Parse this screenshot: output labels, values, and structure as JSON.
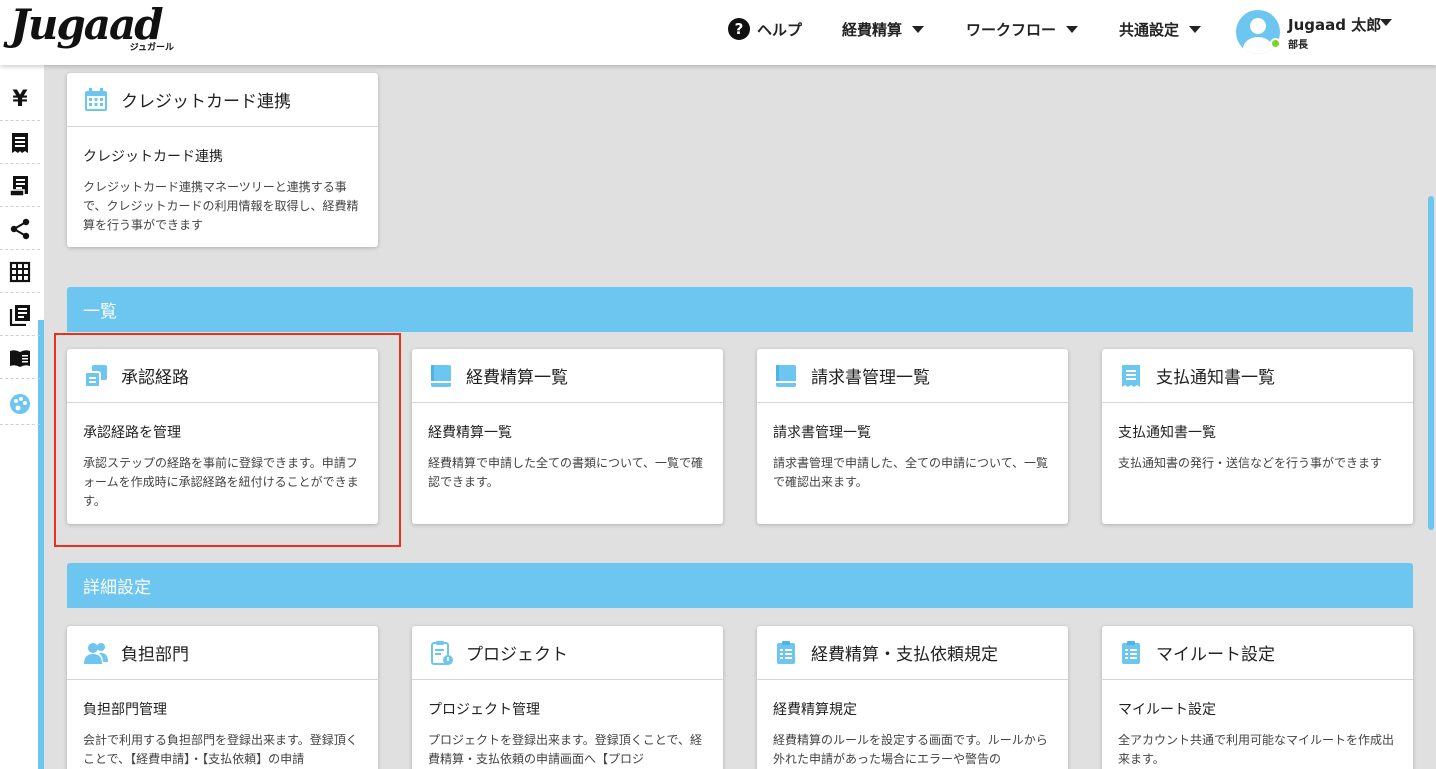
{
  "colors": {
    "accent": "#6cc6ef",
    "highlight": "#e8321c",
    "status_online": "#7ed321"
  },
  "header": {
    "logo_text": "Jugaad",
    "logo_sub": "ジュガール",
    "nav": {
      "help": "ヘルプ",
      "expense": "経費精算",
      "workflow": "ワークフロー",
      "common": "共通設定"
    },
    "user": {
      "name": "Jugaad 太郎",
      "role": "部長"
    }
  },
  "sidebar": {
    "icons": [
      "yen-icon",
      "receipt-icon",
      "invoice-icon",
      "share-icon",
      "grid-icon",
      "library-icon",
      "book-icon",
      "palette-icon"
    ]
  },
  "top_card": {
    "title": "クレジットカード連携",
    "subtitle": "クレジットカード連携",
    "desc": "クレジットカード連携マネーツリーと連携する事で、クレジットカードの利用情報を取得し、経費精算を行う事ができます"
  },
  "sections": {
    "list": "一覧",
    "detail": "詳細設定"
  },
  "list_cards": [
    {
      "title": "承認経路",
      "subtitle": "承認経路を管理",
      "desc": "承認ステップの経路を事前に登録できます。申請フォームを作成時に承認経路を紐付けることができます。"
    },
    {
      "title": "経費精算一覧",
      "subtitle": "経費精算一覧",
      "desc": "経費精算で申請した全ての書類について、一覧で確認できます。"
    },
    {
      "title": "請求書管理一覧",
      "subtitle": "請求書管理一覧",
      "desc": "請求書管理で申請した、全ての申請について、一覧で確認出来ます。"
    },
    {
      "title": "支払通知書一覧",
      "subtitle": "支払通知書一覧",
      "desc": "支払通知書の発行・送信などを行う事ができます"
    }
  ],
  "detail_cards": [
    {
      "title": "負担部門",
      "subtitle": "負担部門管理",
      "desc": "会計で利用する負担部門を登録出来ます。登録頂くことで、【経費申請】・【支払依頼】の申請"
    },
    {
      "title": "プロジェクト",
      "subtitle": "プロジェクト管理",
      "desc": "プロジェクトを登録出来ます。登録頂くことで、経費精算・支払依頼の申請画面へ【プロジ"
    },
    {
      "title": "経費精算・支払依頼規定",
      "subtitle": "経費精算規定",
      "desc": "経費精算のルールを設定する画面です。ルールから外れた申請があった場合にエラーや警告の"
    },
    {
      "title": "マイルート設定",
      "subtitle": "マイルート設定",
      "desc": "全アカウント共通で利用可能なマイルートを作成出来ます。"
    }
  ]
}
